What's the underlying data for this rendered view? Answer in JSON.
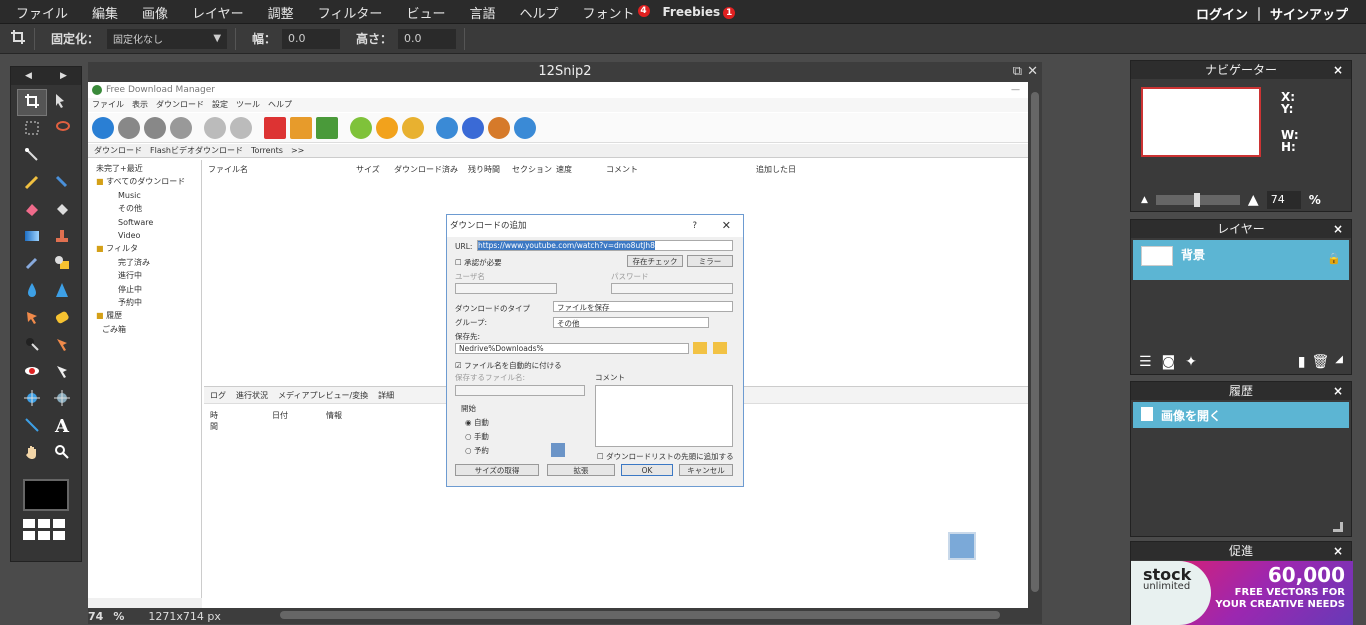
{
  "menu": {
    "items": [
      "ファイル",
      "編集",
      "画像",
      "レイヤー",
      "調整",
      "フィルター",
      "ビュー",
      "言語",
      "ヘルプ",
      "フォント",
      "Freebies"
    ],
    "font_badge": "4",
    "freebies_badge": "1",
    "auth": "ログイン ｜ サインアップ"
  },
  "optionbar": {
    "lock_label": "固定化：",
    "lock_value": "固定化なし",
    "width_label": "幅：",
    "width_value": "0.0",
    "height_label": "高さ：",
    "height_value": "0.0"
  },
  "toolbox": {
    "tools": [
      "crop-icon",
      "move-icon",
      "marquee-icon",
      "lasso-icon",
      "magic-wand-icon",
      "pencil-icon",
      "brush-icon",
      "eraser-icon",
      "bucket-icon",
      "gradient-icon",
      "stamp-icon",
      "color-replace-icon",
      "eyedropper-icon",
      "blur-icon",
      "sharpen-icon",
      "smudge-icon",
      "sponge-icon",
      "burn-icon",
      "dodge-icon",
      "redeye-icon",
      "bloat-icon",
      "pinch-icon",
      "spherize-icon",
      "line-icon",
      "text-icon",
      "hand-icon",
      "zoom-icon"
    ],
    "foreground_color": "#000000"
  },
  "document": {
    "title": "12Snip2",
    "zoom": "74",
    "zoom_unit": "%",
    "size": "1271x714 px"
  },
  "fdm": {
    "title": "Free Download Manager",
    "menu": [
      "ファイル",
      "表示",
      "ダウンロード",
      "設定",
      "ツール",
      "ヘルプ"
    ],
    "tabs": [
      "ダウンロード",
      "Flashビデオダウンロード",
      "Torrents",
      ">>"
    ],
    "tree": [
      "未完了+最近",
      "すべてのダウンロード",
      "Music",
      "その他",
      "Software",
      "Video",
      "フィルタ",
      "完了済み",
      "進行中",
      "停止中",
      "予約中",
      "履歴",
      "ごみ箱"
    ],
    "columns": [
      "ファイル名",
      "サイズ",
      "ダウンロード済み",
      "残り時間",
      "セクション",
      "速度",
      "コメント",
      "追加した日"
    ],
    "lower_tabs": [
      "ログ",
      "進行状況",
      "メディアプレビュー/変換",
      "詳細"
    ],
    "lower_columns": [
      "時間",
      "日付",
      "情報"
    ]
  },
  "dialog": {
    "title": "ダウンロードの追加",
    "help": "?",
    "close": "✕",
    "url_label": "URL:",
    "url_value": "https://www.youtube.com/watch?v=dmo8utJh8",
    "auth_label": "承認が必要",
    "check_button": "存在チェック",
    "more_button": "ミラー",
    "user_label": "ユーザ名",
    "pass_label": "パスワード",
    "type_label": "ダウンロードのタイプ",
    "type_value": "ファイルを保存",
    "group_label": "グループ:",
    "group_value": "その他",
    "saveto_label": "保存先:",
    "saveto_value": "Nedrive%Downloads%",
    "rename_label": "ファイル名を自動的に付ける",
    "filename_label": "保存するファイル名:",
    "comment_label": "コメント",
    "start_label": "開始",
    "start_options": [
      "自動",
      "手動",
      "予約"
    ],
    "add_to_top": "ダウンロードリストの先頭に追加する",
    "buttons": [
      "サイズの取得",
      "拡張",
      "OK",
      "キャンセル"
    ]
  },
  "navigator": {
    "title": "ナビゲーター",
    "x_label": "X:",
    "y_label": "Y:",
    "w_label": "W:",
    "h_label": "H:",
    "zoom": "74",
    "zoom_unit": "%"
  },
  "layers": {
    "title": "レイヤー",
    "items": [
      "背景"
    ]
  },
  "history": {
    "title": "履歴",
    "items": [
      "画像を開く"
    ]
  },
  "promo": {
    "title": "促進",
    "brand": "stock",
    "brand_sub": "unlimited",
    "headline": "60,000",
    "line1": "FREE VECTORS FOR",
    "line2": "YOUR CREATIVE NEEDS"
  }
}
